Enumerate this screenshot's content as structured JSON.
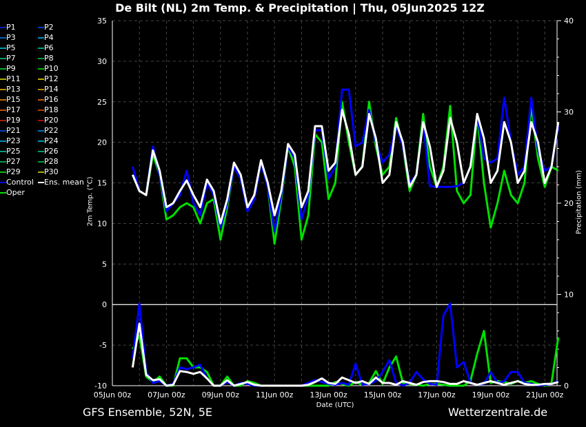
{
  "title": "De Bilt  (NL)  2m Temp. & Precipitation | Thu, 05Jun2025 12Z",
  "footer_left": "GFS Ensemble, 52N, 5E",
  "footer_right": "Wetterzentrale.de",
  "legend": [
    {
      "label": "P1",
      "color": "#0020c0"
    },
    {
      "label": "P2",
      "color": "#0040c0"
    },
    {
      "label": "P3",
      "color": "#0060c0"
    },
    {
      "label": "P4",
      "color": "#0090c0"
    },
    {
      "label": "P5",
      "color": "#00a0b0"
    },
    {
      "label": "P6",
      "color": "#00a080"
    },
    {
      "label": "P7",
      "color": "#00a060"
    },
    {
      "label": "P8",
      "color": "#00a040"
    },
    {
      "label": "P9",
      "color": "#00b020"
    },
    {
      "label": "P10",
      "color": "#00c000"
    },
    {
      "label": "P11",
      "color": "#b0b000"
    },
    {
      "label": "P12",
      "color": "#c0b000"
    },
    {
      "label": "P13",
      "color": "#c09000"
    },
    {
      "label": "P14",
      "color": "#c08000"
    },
    {
      "label": "P15",
      "color": "#c07000"
    },
    {
      "label": "P16",
      "color": "#c06000"
    },
    {
      "label": "P17",
      "color": "#c05000"
    },
    {
      "label": "P18",
      "color": "#b04000"
    },
    {
      "label": "P19",
      "color": "#a02000"
    },
    {
      "label": "P20",
      "color": "#a01010"
    },
    {
      "label": "P21",
      "color": "#0040c0"
    },
    {
      "label": "P22",
      "color": "#0070c0"
    },
    {
      "label": "P23",
      "color": "#0090c0"
    },
    {
      "label": "P24",
      "color": "#00a0b0"
    },
    {
      "label": "P25",
      "color": "#00a080"
    },
    {
      "label": "P26",
      "color": "#00a070"
    },
    {
      "label": "P27",
      "color": "#00a040"
    },
    {
      "label": "P28",
      "color": "#00a030"
    },
    {
      "label": "P29",
      "color": "#00c000"
    },
    {
      "label": "P30",
      "color": "#b0b000"
    },
    {
      "label": "Control",
      "color": "#0000ff"
    },
    {
      "label": "Ens. mean",
      "color": "#ffffff"
    },
    {
      "label": "Oper",
      "color": "#00e000"
    }
  ],
  "chart_data": {
    "type": "line",
    "xlabel": "Date (UTC)",
    "ylabel": "2m Temp. (°C)",
    "y2label": "Precipitation (mm)",
    "ylim": [
      -10,
      35
    ],
    "y2lim": [
      0,
      40
    ],
    "yticks": [
      "35",
      "30",
      "25",
      "20",
      "15",
      "10",
      "5",
      "0",
      "-5",
      "-10"
    ],
    "y2ticks": [
      "40",
      "30",
      "20",
      "10",
      "0"
    ],
    "xticks": [
      "05Jun 00z",
      "07Jun 00z",
      "09Jun 00z",
      "11Jun 00z",
      "13Jun 00z",
      "15Jun 00z",
      "17Jun 00z",
      "19Jun 00z",
      "21Jun 00z"
    ],
    "x_start": "05Jun 18z",
    "x_step_hours": 6,
    "grid": true,
    "legend_position": "left",
    "temperature": [
      {
        "name": "Ens. mean",
        "color": "#ffffff",
        "values": [
          16,
          14,
          13.5,
          19,
          16.5,
          12,
          12.5,
          14,
          15.3,
          13.5,
          12,
          15.4,
          14,
          10,
          13,
          17.5,
          16,
          12,
          13.5,
          17.8,
          15,
          11,
          14,
          19.8,
          18.5,
          12,
          14,
          22,
          22,
          16.5,
          17.5,
          24,
          21,
          16,
          17,
          23.5,
          20.5,
          15,
          16,
          22.5,
          20,
          14.5,
          16,
          22.5,
          19.5,
          14.5,
          16.5,
          23,
          20,
          15,
          17,
          23.5,
          20.5,
          15,
          16.5,
          22.5,
          20,
          15,
          16.5,
          22.5,
          20,
          15,
          17,
          22.5
        ]
      },
      {
        "name": "Control",
        "color": "#0000ff",
        "values": [
          17,
          14,
          13.5,
          19.5,
          16,
          11.5,
          12.5,
          13.5,
          16.5,
          12.5,
          11,
          15,
          13.5,
          9.5,
          12.5,
          17,
          15.5,
          11.5,
          13,
          17.5,
          14.5,
          9,
          13.5,
          19.5,
          18,
          10.5,
          13.5,
          21.5,
          21.5,
          15.5,
          17,
          26.5,
          26.5,
          19.5,
          20,
          24,
          20,
          17.5,
          18.5,
          22,
          19.5,
          15,
          16,
          22.5,
          14.6,
          14.5,
          14.5,
          14.5,
          14.6,
          15,
          17,
          23.5,
          18,
          17.5,
          18,
          25.5,
          20,
          16,
          17,
          25.5,
          19,
          16.5,
          17,
          22
        ]
      },
      {
        "name": "Oper",
        "color": "#00e000",
        "values": [
          16,
          14,
          13.5,
          18.5,
          16,
          10.5,
          11,
          12,
          12.5,
          12,
          10,
          12.5,
          13,
          8,
          12,
          17,
          15.5,
          11.5,
          13,
          17.5,
          14.5,
          7.5,
          13,
          19.5,
          17,
          8,
          11,
          21,
          20,
          13,
          15,
          25,
          20,
          16,
          17,
          25,
          19.5,
          16,
          17,
          23,
          19.5,
          14,
          16,
          23.5,
          17,
          14.5,
          17,
          24.5,
          14,
          12.5,
          13.5,
          23.5,
          15,
          9.5,
          12.5,
          16.5,
          13.5,
          12.5,
          15,
          24.5,
          18,
          14.5,
          17,
          16.5
        ]
      }
    ],
    "precipitation": [
      {
        "name": "Ens. mean",
        "color": "#ffffff",
        "values": [
          2.0,
          6.8,
          1.2,
          0.6,
          0.7,
          0,
          0.1,
          1.6,
          1.5,
          1.3,
          1.5,
          0.8,
          0,
          0,
          0.6,
          0,
          0.2,
          0.4,
          0.1,
          0,
          0,
          0,
          0,
          0,
          0,
          0,
          0.1,
          0.4,
          0.8,
          0.3,
          0.2,
          0.9,
          0.6,
          0.3,
          0.5,
          0.2,
          0.9,
          0.3,
          0.3,
          0.1,
          0.5,
          0.3,
          0.1,
          0.4,
          0.5,
          0.5,
          0.4,
          0.2,
          0.2,
          0.5,
          0.3,
          0.1,
          0.3,
          0.5,
          0.3,
          0.1,
          0.3,
          0.5,
          0.2,
          0.1,
          0.1,
          0.2,
          0.2,
          0.4
        ]
      },
      {
        "name": "Control",
        "color": "#0000ff",
        "values": [
          3.0,
          9.0,
          1.5,
          0.3,
          0.5,
          0,
          0.2,
          2.0,
          1.8,
          2.0,
          2.3,
          0.8,
          0,
          0,
          0.4,
          0,
          0.3,
          0.2,
          0,
          0,
          0,
          0,
          0,
          0,
          0,
          0,
          0.3,
          0.6,
          0.4,
          0.2,
          0.1,
          0.3,
          0.1,
          2.4,
          0.1,
          0.2,
          0.5,
          1.5,
          2.8,
          0.3,
          0,
          0.3,
          1.5,
          0.7,
          0.2,
          0.1,
          7.7,
          9.0,
          2.0,
          2.6,
          0.3,
          0.1,
          0.2,
          1.5,
          0.3,
          0.5,
          1.5,
          1.5,
          0.3,
          0.2,
          0,
          0.1,
          0.2,
          0.5
        ]
      },
      {
        "name": "Oper",
        "color": "#00e000",
        "values": [
          4.0,
          5.5,
          1.0,
          0.4,
          1.0,
          0,
          0,
          3.0,
          3.0,
          2.0,
          2.0,
          1.5,
          0,
          0,
          1.0,
          0,
          0,
          0.5,
          0.3,
          0,
          0,
          0,
          0,
          0,
          0,
          0,
          0,
          0,
          0,
          0,
          0.4,
          0.2,
          0,
          0.4,
          0.1,
          0.3,
          1.6,
          0.2,
          2.0,
          3.2,
          0.3,
          0.2,
          0.1,
          0,
          0.2,
          0.2,
          0.1,
          0,
          0,
          0,
          0.5,
          3.5,
          6.0,
          0.3,
          0.5,
          0.4,
          0.2,
          0.5,
          0.3,
          0.5,
          0.2,
          0,
          0.3,
          5.3
        ]
      }
    ]
  }
}
